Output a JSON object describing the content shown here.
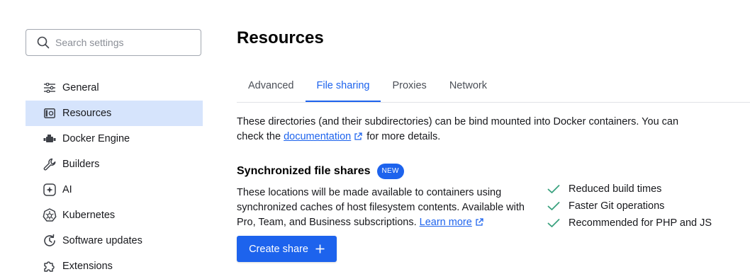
{
  "search": {
    "placeholder": "Search settings"
  },
  "sidebar": {
    "items": [
      {
        "label": "General",
        "icon": "sliders-icon"
      },
      {
        "label": "Resources",
        "icon": "resources-icon",
        "active": true
      },
      {
        "label": "Docker Engine",
        "icon": "docker-engine-icon"
      },
      {
        "label": "Builders",
        "icon": "wrench-icon"
      },
      {
        "label": "AI",
        "icon": "ai-icon"
      },
      {
        "label": "Kubernetes",
        "icon": "kubernetes-icon"
      },
      {
        "label": "Software updates",
        "icon": "software-updates-icon"
      },
      {
        "label": "Extensions",
        "icon": "puzzle-icon"
      }
    ]
  },
  "main": {
    "title": "Resources",
    "tabs": [
      {
        "label": "Advanced"
      },
      {
        "label": "File sharing",
        "active": true
      },
      {
        "label": "Proxies"
      },
      {
        "label": "Network"
      }
    ],
    "description": {
      "line1": "These directories (and their subdirectories) can be bind mounted into Docker containers. You can",
      "prefix": "check the",
      "link": "documentation",
      "suffix": "for more details."
    },
    "sync": {
      "title": "Synchronized file shares",
      "badge": "NEW",
      "description": "These locations will be made available to containers using synchronized caches of host filesystem contents. Available with Pro, Team, and Business subscriptions.",
      "learn_more": "Learn more",
      "button": "Create share",
      "features": [
        "Reduced build times",
        "Faster Git operations",
        "Recommended for PHP and JS"
      ]
    }
  },
  "colors": {
    "accent": "#1d63ed",
    "active_bg": "#d6e4fc",
    "check": "#3aa17e"
  }
}
